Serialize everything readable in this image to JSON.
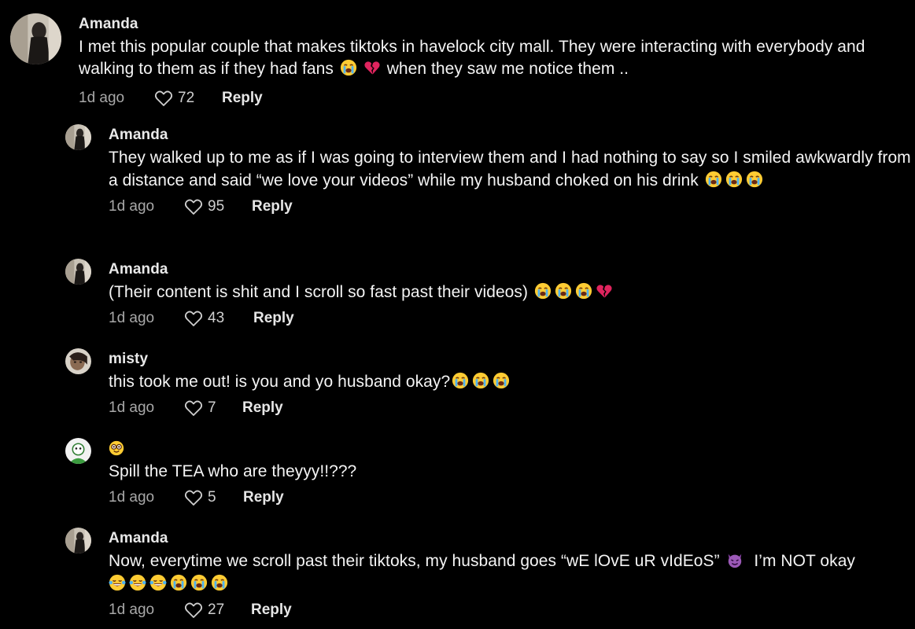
{
  "comments": [
    {
      "username": "Amanda",
      "text_parts": [
        "I met this popular couple that makes tiktoks in havelock city mall. They were interacting with everybody and walking to them as if they had fans ",
        " when they saw me notice them .."
      ],
      "emojis_between": [
        "loudly-crying-face",
        "broken-heart"
      ],
      "time": "1d ago",
      "likes": "72",
      "reply_label": "Reply",
      "avatar": "avatar-amanda-icon"
    },
    {
      "username": "Amanda",
      "text": "They walked up to me as if I was going to interview them and I had nothing to say so I smiled awkwardly from a distance and said “we love your videos” while my husband choked on his drink",
      "trailing_emojis": [
        "loudly-crying-face",
        "loudly-crying-face",
        "loudly-crying-face"
      ],
      "time": "1d ago",
      "likes": "95",
      "reply_label": "Reply",
      "avatar": "avatar-amanda-icon"
    },
    {
      "username": "Amanda",
      "text": "(Their content is shit and I scroll so fast past their videos)",
      "trailing_emojis": [
        "loudly-crying-face",
        "loudly-crying-face",
        "loudly-crying-face",
        "broken-heart"
      ],
      "time": "1d ago",
      "likes": "43",
      "reply_label": "Reply",
      "avatar": "avatar-amanda-icon"
    },
    {
      "username": "misty",
      "text": "this took me out! is you and yo husband okay?",
      "trailing_emojis": [
        "loudly-crying-face",
        "loudly-crying-face",
        "loudly-crying-face"
      ],
      "time": "1d ago",
      "likes": "7",
      "reply_label": "Reply",
      "avatar": "avatar-misty-icon"
    },
    {
      "username_emoji": "face-with-glasses",
      "text": "Spill the TEA who are theyyy!!???",
      "time": "1d ago",
      "likes": "5",
      "reply_label": "Reply",
      "avatar": "avatar-green-icon"
    },
    {
      "username": "Amanda",
      "text_parts": [
        "Now, everytime we scroll past their tiktoks, my husband goes “wE lOvE uR vIdEoS” ",
        " I’m NOT okay"
      ],
      "emojis_between": [
        "smiling-face-with-horns"
      ],
      "trailing_emojis": [
        "tears-of-joy",
        "tears-of-joy",
        "tears-of-joy",
        "loudly-crying-face",
        "loudly-crying-face",
        "loudly-crying-face"
      ],
      "time": "1d ago",
      "likes": "27",
      "reply_label": "Reply",
      "avatar": "avatar-amanda-icon"
    }
  ],
  "colors": {
    "background": "#000000",
    "text": "#f4f4f4",
    "muted": "#a8a8a8"
  }
}
